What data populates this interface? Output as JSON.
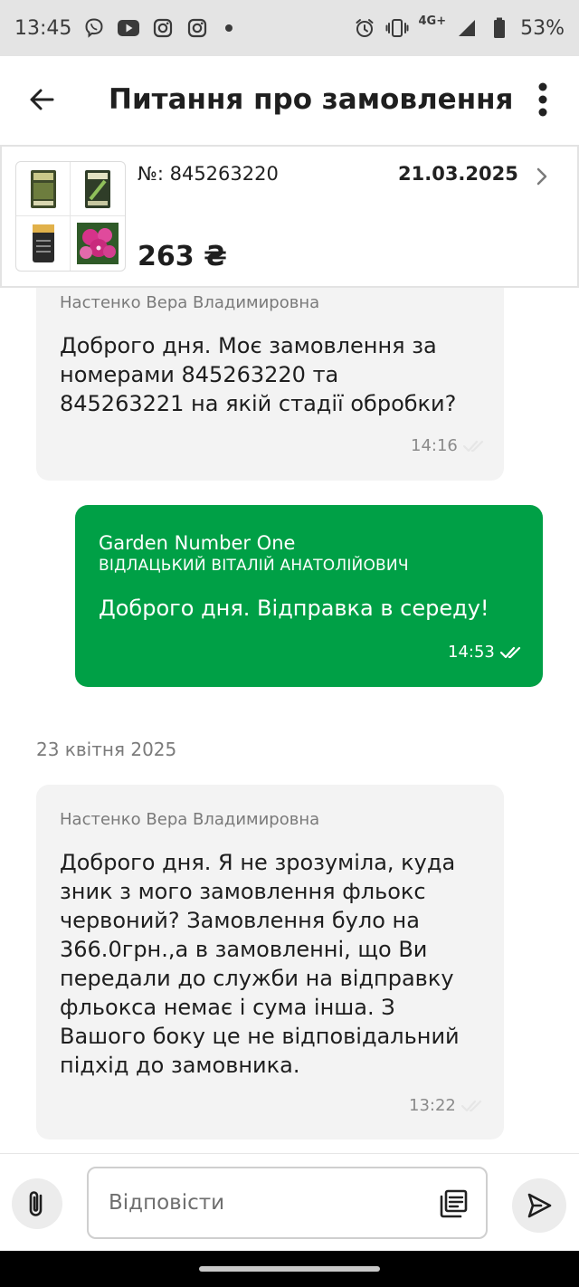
{
  "status_bar": {
    "time": "13:45",
    "network": "4G+",
    "battery": "53%",
    "left_icons": [
      "viber-icon",
      "youtube-icon",
      "instagram-icon",
      "instagram-icon",
      "dot-icon"
    ],
    "right_icons": [
      "alarm-icon",
      "vibrate-icon",
      "signal-icon",
      "battery-icon"
    ]
  },
  "header": {
    "title": "Питання про замовлення"
  },
  "order": {
    "number": "№: 845263220",
    "date": "21.03.2025",
    "price": "263 ₴"
  },
  "messages": [
    {
      "direction": "incoming",
      "sender": "Настенко Вера Владимировна",
      "text": "Доброго дня. Моє замовлення за номерами 845263220 та 845263221 на якій стадії обробки?",
      "time": "14:16"
    },
    {
      "direction": "outgoing",
      "company": "Garden Number One",
      "sender": "ВІДЛАЦЬКИЙ ВІТАЛІЙ АНАТОЛІЙОВИЧ",
      "text": "Доброго дня. Відправка в середу!",
      "time": "14:53"
    },
    {
      "direction": "incoming",
      "sender": "Настенко Вера Владимировна",
      "text": "Доброго дня. Я не зрозуміла, куда зник з мого замовлення фльокс червоний? Замовлення було на 366.0грн.,а в замовленні, що Ви передали до служби на відправку фльокса немає і сума інша. З Вашого боку це не відповідальний підхід до замовника.",
      "time": "13:22"
    }
  ],
  "date_separator": "23 квітня 2025",
  "composer": {
    "placeholder": "Відповісти",
    "value": ""
  },
  "colors": {
    "accent": "#00a046",
    "incoming_bubble": "#f3f3f3",
    "status_bar": "#e4e4e4"
  }
}
